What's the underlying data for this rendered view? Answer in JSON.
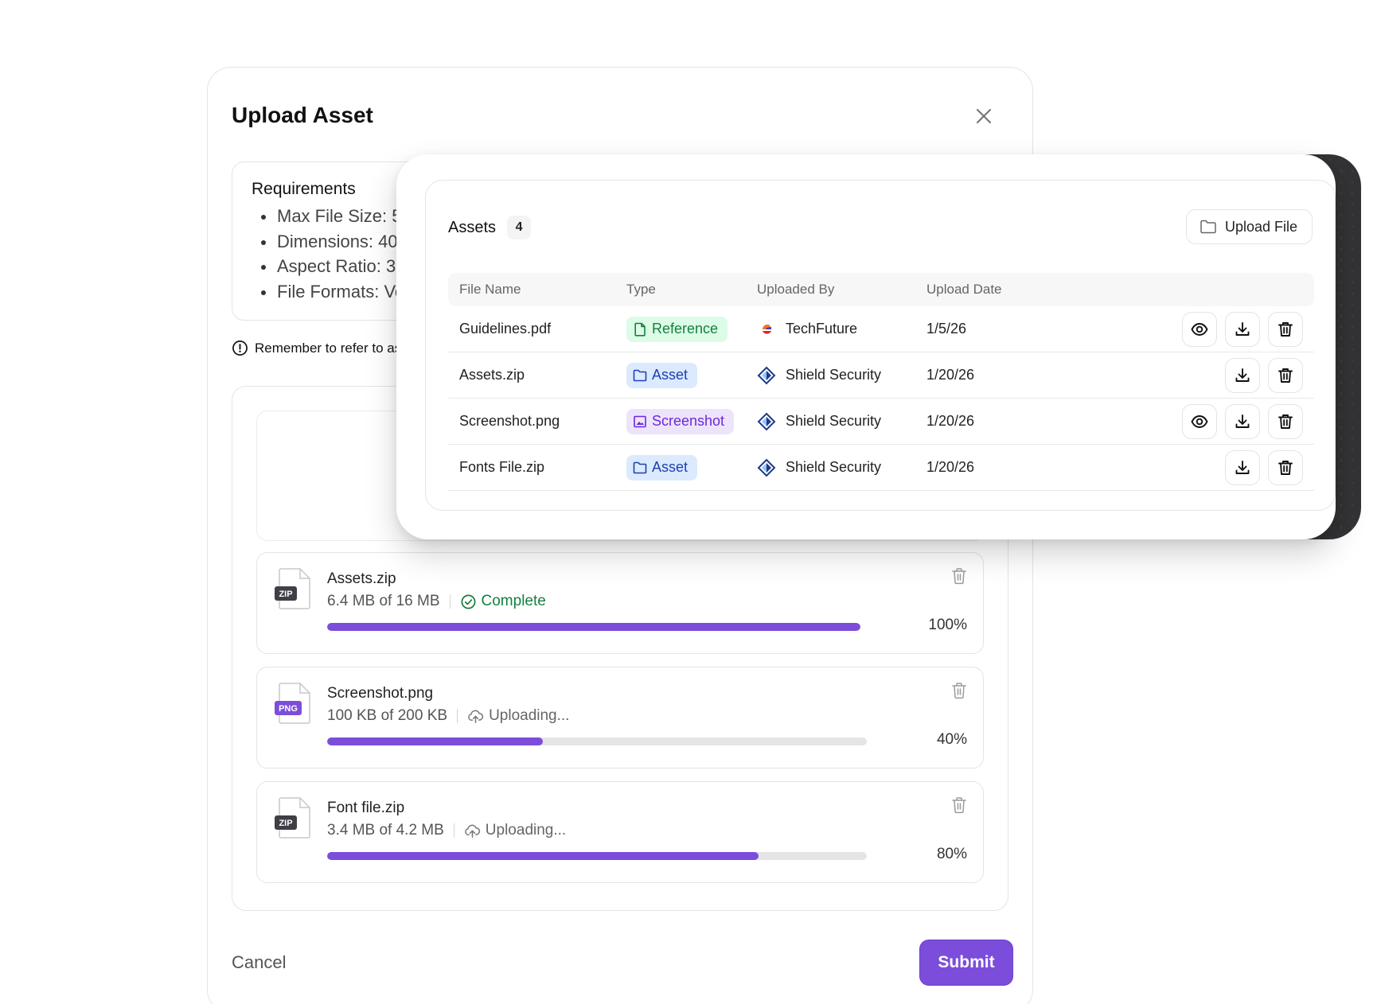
{
  "upload_modal": {
    "title": "Upload Asset",
    "requirements": {
      "title": "Requirements",
      "items": [
        "Max File Size: 5",
        "Dimensions: 40",
        "Aspect Ratio: 3",
        "File Formats: Ve"
      ]
    },
    "reminder": "Remember to refer to as",
    "files": [
      {
        "name": "Assets.zip",
        "ext": "ZIP",
        "ext_color": "#3f3f46",
        "size": "6.4 MB of 16 MB",
        "status": "Complete",
        "status_kind": "complete",
        "progress": 100,
        "percent_label": "100%"
      },
      {
        "name": "Screenshot.png",
        "ext": "PNG",
        "ext_color": "#7c4ddb",
        "size": "100 KB of 200 KB",
        "status": "Uploading...",
        "status_kind": "uploading",
        "progress": 40,
        "percent_label": "40%"
      },
      {
        "name": "Font file.zip",
        "ext": "ZIP",
        "ext_color": "#3f3f46",
        "size": "3.4 MB of 4.2 MB",
        "status": "Uploading...",
        "status_kind": "uploading",
        "progress": 80,
        "percent_label": "80%"
      }
    ],
    "cancel_label": "Cancel",
    "submit_label": "Submit"
  },
  "assets_panel": {
    "title": "Assets",
    "count": "4",
    "upload_button_label": "Upload File",
    "columns": [
      "File Name",
      "Type",
      "Uploaded By",
      "Upload Date"
    ],
    "rows": [
      {
        "file_name": "Guidelines.pdf",
        "type": "Reference",
        "type_icon": "document-icon",
        "uploaded_by": "TechFuture",
        "uploader_logo": "techfuture-logo",
        "date": "1/5/26",
        "can_preview": true
      },
      {
        "file_name": "Assets.zip",
        "type": "Asset",
        "type_icon": "folder-icon",
        "uploaded_by": "Shield Security",
        "uploader_logo": "shield-security-logo",
        "date": "1/20/26",
        "can_preview": false
      },
      {
        "file_name": "Screenshot.png",
        "type": "Screenshot",
        "type_icon": "image-icon",
        "uploaded_by": "Shield Security",
        "uploader_logo": "shield-security-logo",
        "date": "1/20/26",
        "can_preview": true
      },
      {
        "file_name": "Fonts File.zip",
        "type": "Asset",
        "type_icon": "folder-icon",
        "uploaded_by": "Shield Security",
        "uploader_logo": "shield-security-logo",
        "date": "1/20/26",
        "can_preview": false
      }
    ]
  },
  "colors": {
    "accent": "#7c4ddb",
    "complete": "#15803d",
    "reference_bg": "#dcfce7",
    "asset_bg": "#dbeafe",
    "screenshot_bg": "#ede4fb"
  }
}
